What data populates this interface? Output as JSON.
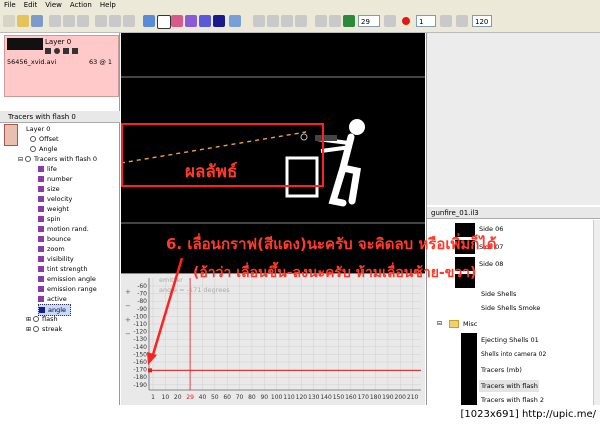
{
  "menu": [
    "File",
    "Edit",
    "View",
    "Action",
    "Help"
  ],
  "toolbar": {
    "frame_value": "29",
    "speed_value": "1",
    "fps_value": "120"
  },
  "layer_panel": {
    "layer_name": "Layer 0",
    "file_name": "56456_xvid.avi",
    "frame_info": "63 @ 1"
  },
  "tree_panel": {
    "title": "Tracers with flash 0",
    "items": [
      {
        "label": "Layer 0",
        "level": 0
      },
      {
        "label": "Offset",
        "level": 1
      },
      {
        "label": "Angle",
        "level": 1
      },
      {
        "label": "Tracers with flash 0",
        "level": 1
      },
      {
        "label": "life",
        "level": 2
      },
      {
        "label": "number",
        "level": 2
      },
      {
        "label": "size",
        "level": 2
      },
      {
        "label": "velocity",
        "level": 2
      },
      {
        "label": "weight",
        "level": 2
      },
      {
        "label": "spin",
        "level": 2
      },
      {
        "label": "motion rand.",
        "level": 2
      },
      {
        "label": "bounce",
        "level": 2
      },
      {
        "label": "zoom",
        "level": 2
      },
      {
        "label": "visibility",
        "level": 2
      },
      {
        "label": "tint strength",
        "level": 2
      },
      {
        "label": "emission angle",
        "level": 2
      },
      {
        "label": "emission range",
        "level": 2
      },
      {
        "label": "active",
        "level": 2
      },
      {
        "label": "angle",
        "level": 2,
        "selected": true
      },
      {
        "label": "flash",
        "level": 1
      },
      {
        "label": "streak",
        "level": 1
      }
    ]
  },
  "canvas": {
    "annotation_label": "ผลลัพธ์"
  },
  "graph": {
    "y_ticks": [
      "-60",
      "-70",
      "-80",
      "-90",
      "-100",
      "-110",
      "-120",
      "-130",
      "-140",
      "-150",
      "-160",
      "-170",
      "-180",
      "-190"
    ],
    "x_ticks": [
      "1",
      "10",
      "20",
      "29",
      "40",
      "50",
      "60",
      "70",
      "80",
      "90",
      "100",
      "110",
      "120",
      "130",
      "140",
      "150",
      "160",
      "170",
      "180",
      "190",
      "200",
      "210"
    ],
    "highlight_x": "29",
    "series_label": "emitter",
    "value_label": "angle = -171 degrees"
  },
  "right_panel": {
    "title": "gunfire_01.il3",
    "items": [
      "Side 06",
      "Side 07",
      "Side 08",
      "Side Shells",
      "Side Shells Smoke",
      "Misc",
      "Ejecting Shells 01",
      "Shells into camera 02",
      "Tracers (mb)",
      "Tracers with flash",
      "Tracers with flash 2"
    ]
  },
  "annotation": {
    "line1": "6. เลื่อนกราฟ(สีแดง)นะครับ จะคิดลบ หรือเพิ่มก็ได้",
    "line2": "(อ้าว่า เลื่อนขึ้น-ลงนะครับ ห้ามเลื่อนซ้าย-ขวา)"
  },
  "footer": {
    "text": "[1023x691] http://upic.me/"
  },
  "colors": {
    "accent_red": "#ff2020",
    "annotation_text": "#ff3a2a"
  }
}
